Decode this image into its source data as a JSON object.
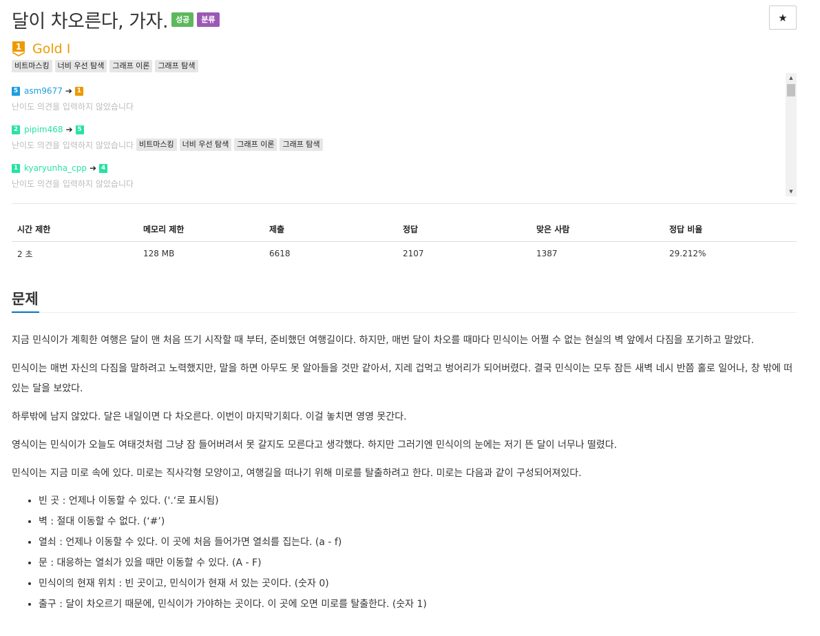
{
  "header": {
    "title": "달이 차오른다, 가자.",
    "badges": [
      {
        "label": "성공",
        "color": "#5cb85c"
      },
      {
        "label": "분류",
        "color": "#9b59b6"
      }
    ],
    "star": "★"
  },
  "tier": {
    "icon_number": "1",
    "label": "Gold I",
    "color": "#ec9a00"
  },
  "tags": [
    "비트마스킹",
    "너비 우선 탐색",
    "그래프 이론",
    "그래프 탐색"
  ],
  "opinions": [
    {
      "from_level": "5",
      "from_color": "#1e9ede",
      "name": "asm9677",
      "name_color": "#1e9ede",
      "to_level": "1",
      "to_color": "#ec9a00",
      "note": "난이도 의견을 입력하지 않았습니다",
      "tags": []
    },
    {
      "from_level": "2",
      "from_color": "#27e2a4",
      "name": "pipim468",
      "name_color": "#27e2a4",
      "to_level": "5",
      "to_color": "#27e2a4",
      "note": "난이도 의견을 입력하지 않았습니다",
      "tags": [
        "비트마스킹",
        "너비 우선 탐색",
        "그래프 이론",
        "그래프 탐색"
      ]
    },
    {
      "from_level": "1",
      "from_color": "#27e2a4",
      "name": "kyaryunha_cpp",
      "name_color": "#27e2a4",
      "to_level": "4",
      "to_color": "#27e2a4",
      "note": "난이도 의견을 입력하지 않았습니다",
      "tags": []
    }
  ],
  "stats": {
    "headers": [
      "시간 제한",
      "메모리 제한",
      "제출",
      "정답",
      "맞은 사람",
      "정답 비율"
    ],
    "values": [
      "2 초",
      "128 MB",
      "6618",
      "2107",
      "1387",
      "29.212%"
    ]
  },
  "problem": {
    "section_title": "문제",
    "paragraphs": [
      "지금 민식이가 계획한 여행은 달이 맨 처음 뜨기 시작할 때 부터, 준비했던 여행길이다. 하지만, 매번 달이 차오를 때마다 민식이는 어쩔 수 없는 현실의 벽 앞에서 다짐을 포기하고 말았다.",
      "민식이는 매번 자신의 다짐을 말하려고 노력했지만, 말을 하면 아무도 못 알아들을 것만 같아서, 지레 겁먹고 벙어리가 되어버렸다. 결국 민식이는 모두 잠든 새벽 네시 반쯤 홀로 일어나, 창 밖에 떠있는 달을 보았다.",
      "하루밖에 남지 않았다. 달은 내일이면 다 차오른다. 이번이 마지막기회다. 이걸 놓치면 영영 못간다.",
      "영식이는 민식이가 오늘도 여태것처럼 그냥 잠 들어버려서 못 갈지도 모른다고 생각했다. 하지만 그러기엔 민식이의 눈에는 저기 뜬 달이 너무나 떨렸다.",
      "민식이는 지금 미로 속에 있다. 미로는 직사각형 모양이고, 여행길을 떠나기 위해 미로를 탈출하려고 한다. 미로는 다음과 같이 구성되어져있다."
    ],
    "list": [
      "빈 곳 : 언제나 이동할 수 있다. ('.‘로 표시됨)",
      "벽 : 절대 이동할 수 없다. (‘#’)",
      "열쇠 : 언제나 이동할 수 있다. 이 곳에 처음 들어가면 열쇠를 집는다. (a - f)",
      "문 : 대응하는 열쇠가 있을 때만 이동할 수 있다. (A - F)",
      "민식이의 현재 위치 : 빈 곳이고, 민식이가 현재 서 있는 곳이다. (숫자 0)",
      "출구 : 달이 차오르기 때문에, 민식이가 가야하는 곳이다. 이 곳에 오면 미로를 탈출한다. (숫자 1)"
    ]
  }
}
